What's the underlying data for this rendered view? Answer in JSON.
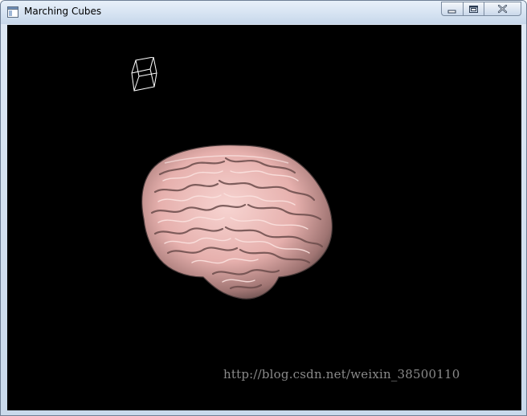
{
  "window": {
    "title": "Marching Cubes",
    "icon": "app-window-icon"
  },
  "caption_buttons": {
    "minimize_icon": "minimize-icon",
    "maximize_icon": "restore-icon",
    "close_icon": "close-icon"
  },
  "viewport": {
    "background": "#000000",
    "objects": [
      "wireframe-cube",
      "brain-isosurface"
    ],
    "mesh_color": "#f2c6c4"
  },
  "watermark": {
    "text": "http://blog.csdn.net/weixin_38500110"
  }
}
